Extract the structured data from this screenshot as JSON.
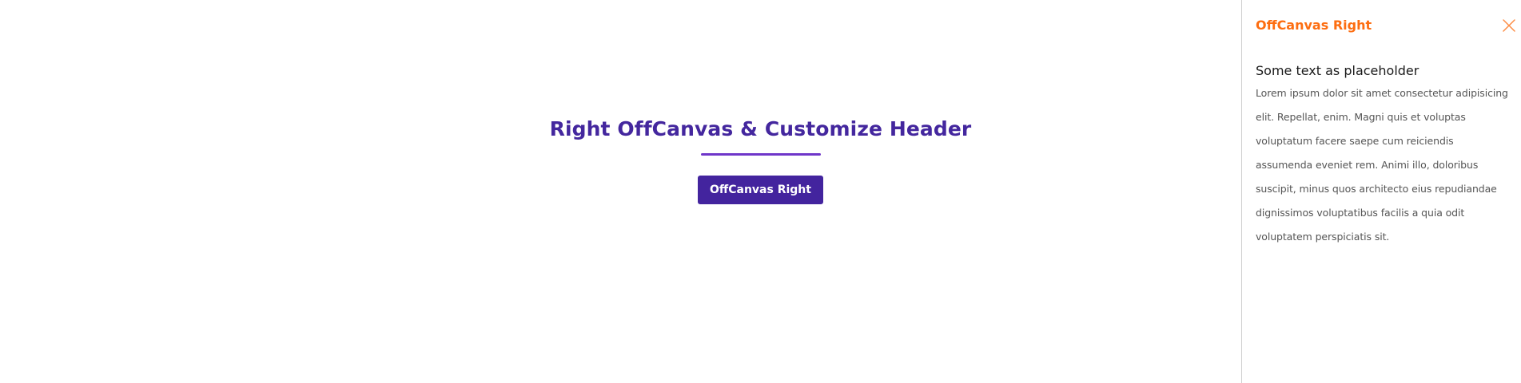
{
  "main": {
    "heading": "Right OffCanvas & Customize Header",
    "open_button_label": "OffCanvas Right",
    "accent_color": "#44279e"
  },
  "offcanvas": {
    "title": "OffCanvas Right",
    "title_color": "#fd6d10",
    "close_icon": "close-icon",
    "subtitle": "Some text as placeholder",
    "body_text": "Lorem ipsum dolor sit amet consectetur adipisicing elit. Repellat, enim. Magni quis et voluptas voluptatum facere saepe cum reiciendis assumenda eveniet rem. Animi illo, doloribus suscipit, minus quos architecto eius repudiandae dignissimos voluptatibus facilis a quia odit voluptatem perspiciatis sit."
  }
}
